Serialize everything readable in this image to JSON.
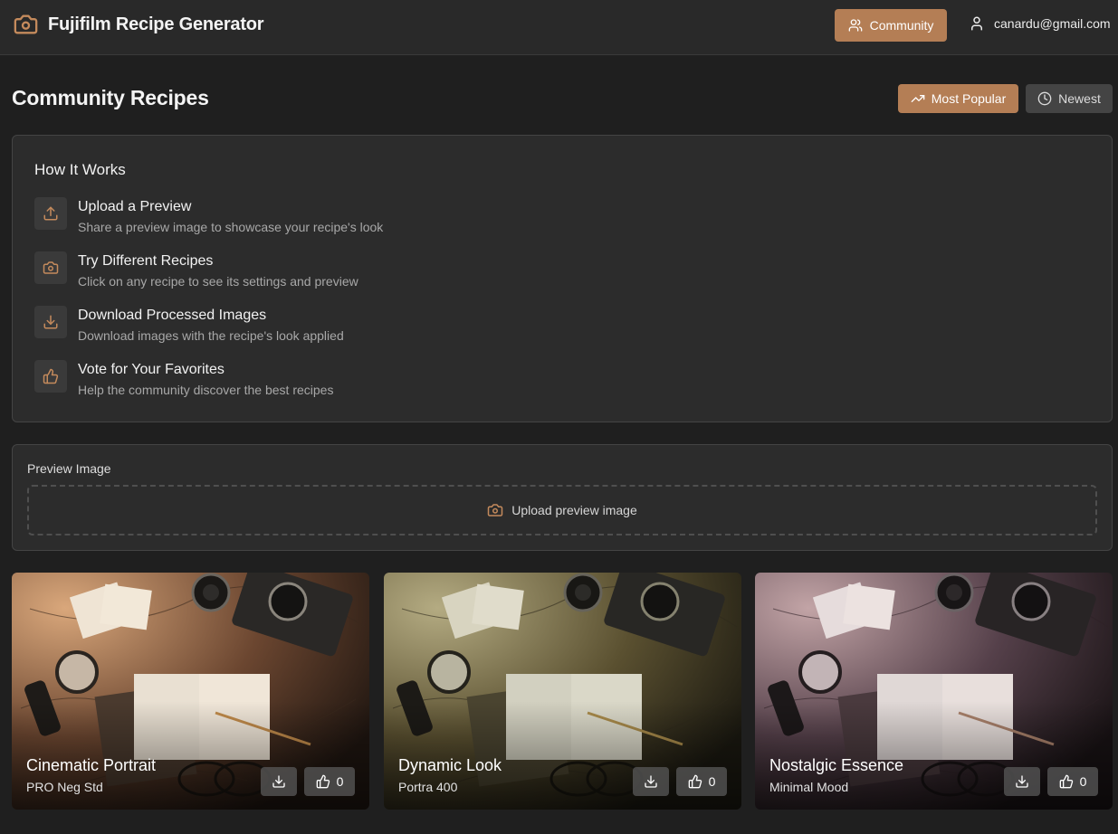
{
  "header": {
    "app_title": "Fujifilm Recipe Generator",
    "logo_icon": "camera-icon",
    "community_label": "Community",
    "user_email": "canardu@gmail.com",
    "accent_color": "#b47e55"
  },
  "page": {
    "title": "Community Recipes",
    "sort": {
      "popular_label": "Most Popular",
      "newest_label": "Newest",
      "active": "Most Popular"
    }
  },
  "how_it_works": {
    "title": "How It Works",
    "steps": [
      {
        "icon": "upload-icon",
        "title": "Upload a Preview",
        "description": "Share a preview image to showcase your recipe's look"
      },
      {
        "icon": "camera-icon",
        "title": "Try Different Recipes",
        "description": "Click on any recipe to see its settings and preview"
      },
      {
        "icon": "download-icon",
        "title": "Download Processed Images",
        "description": "Download images with the recipe's look applied"
      },
      {
        "icon": "thumbs-up-icon",
        "title": "Vote for Your Favorites",
        "description": "Help the community discover the best recipes"
      }
    ]
  },
  "preview": {
    "label": "Preview Image",
    "upload_label": "Upload preview image"
  },
  "recipes": [
    {
      "name": "Cinematic Portrait",
      "film": "PRO Neg Std",
      "votes": "0",
      "tint": "#c88a5a"
    },
    {
      "name": "Dynamic Look",
      "film": "Portra 400",
      "votes": "0",
      "tint": "#a9a070"
    },
    {
      "name": "Nostalgic Essence",
      "film": "Minimal Mood",
      "votes": "0",
      "tint": "#a88a8e"
    }
  ]
}
